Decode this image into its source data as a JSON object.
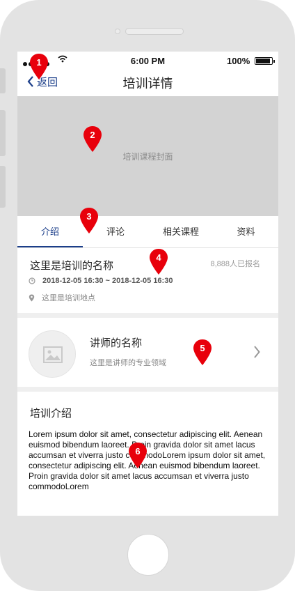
{
  "status_bar": {
    "time": "6:00 PM",
    "battery": "100%"
  },
  "nav": {
    "back_label": "返回",
    "title": "培训详情"
  },
  "cover": {
    "label": "培训课程封面"
  },
  "tabs": [
    {
      "label": "介绍",
      "active": true
    },
    {
      "label": "评论"
    },
    {
      "label": "相关课程"
    },
    {
      "label": "资料"
    }
  ],
  "training": {
    "name": "这里是培训的名称",
    "enrolled": "8,888人已报名",
    "datetime": "2018-12-05  16:30 ~ 2018-12-05  16:30",
    "location": "这里是培训地点"
  },
  "lecturer": {
    "name": "讲师的名称",
    "field": "这里是讲师的专业领域"
  },
  "intro": {
    "title": "培训介绍",
    "body": "Lorem ipsum dolor sit amet, consectetur adipiscing elit. Aenean euismod bibendum laoreet. Proin gravida dolor sit amet lacus accumsan et viverra justo commodoLorem ipsum dolor sit amet, consectetur adipiscing elit. Aenean euismod bibendum laoreet. Proin gravida dolor sit amet lacus accumsan et viverra justo commodoLorem"
  },
  "markers": [
    "1",
    "2",
    "3",
    "4",
    "5",
    "6"
  ],
  "colors": {
    "accent": "#1b3e8a",
    "marker": "#e8000b",
    "cover": "#d3d3d3"
  }
}
